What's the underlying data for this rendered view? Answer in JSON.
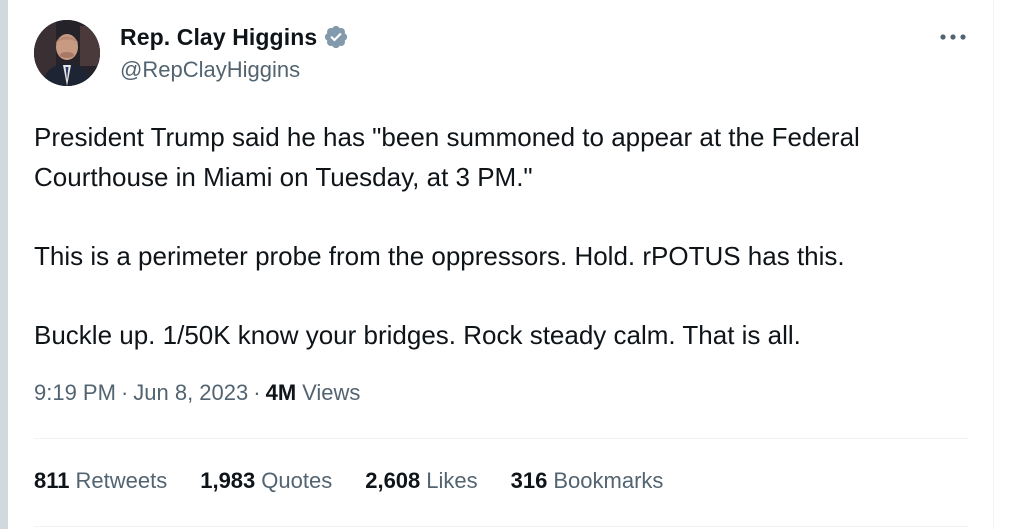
{
  "author": {
    "display_name": "Rep. Clay Higgins",
    "handle": "@RepClayHiggins",
    "verified_color": "#829aab"
  },
  "icons": {
    "avatar": "profile-photo",
    "verified": "verified-badge-icon",
    "more": "more-horizontal-icon"
  },
  "tweet": {
    "paragraphs": [
      "President Trump said he has \"been summoned to appear at the Federal Courthouse in Miami on Tuesday, at 3 PM.\"",
      "This is a perimeter probe from the oppressors. Hold. rPOTUS has this.",
      "Buckle up. 1/50K know your bridges. Rock steady calm. That is all."
    ]
  },
  "meta": {
    "time": "9:19 PM",
    "separator": "·",
    "date": "Jun 8, 2023",
    "views_count": "4M",
    "views_label": "Views"
  },
  "stats": [
    {
      "count": "811",
      "label": "Retweets"
    },
    {
      "count": "1,983",
      "label": "Quotes"
    },
    {
      "count": "2,608",
      "label": "Likes"
    },
    {
      "count": "316",
      "label": "Bookmarks"
    }
  ],
  "colors": {
    "text": "#0f1419",
    "secondary": "#536471",
    "divider": "#eff3f4"
  }
}
